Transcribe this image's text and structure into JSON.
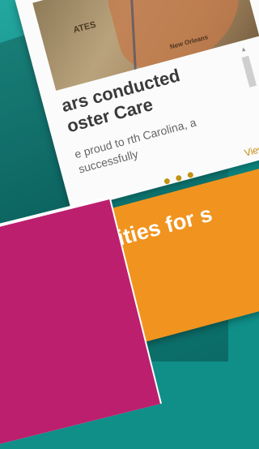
{
  "card": {
    "map_labels": [
      "ATES",
      "New Orleans"
    ],
    "title": "ars conducted oster Care",
    "body": "e proud to rth Carolina, a successfully",
    "view_all": "View All"
  },
  "banner": {
    "text": "nities for s"
  },
  "colors": {
    "teal": "#0f8f88",
    "orange": "#f0941f",
    "magenta": "#bd1f6f",
    "gold": "#c29313"
  },
  "carousel": {
    "dot_count": 3
  }
}
